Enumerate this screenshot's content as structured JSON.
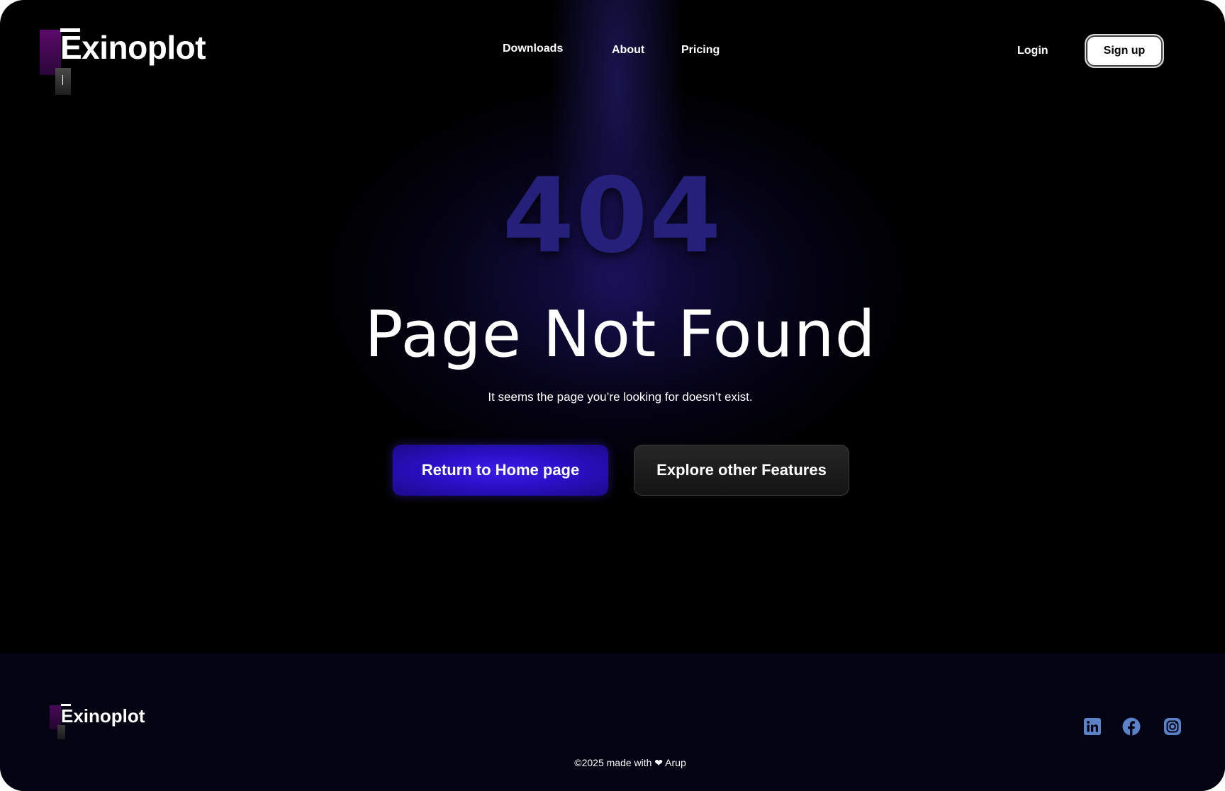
{
  "brand": {
    "name": "Exinoplot"
  },
  "nav": {
    "downloads": "Downloads",
    "about": "About",
    "pricing": "Pricing"
  },
  "auth": {
    "login": "Login",
    "signup": "Sign up"
  },
  "hero": {
    "code": "404",
    "title": "Page Not Found",
    "subtitle": "It seems the page you’re looking for doesn’t exist.",
    "primary_button": "Return to Home page",
    "secondary_button": "Explore other Features"
  },
  "footer": {
    "brand": "Exinoplot",
    "copyright": "©2025 made with ❤ Arup",
    "social_icons": [
      "linkedin-icon",
      "facebook-icon",
      "instagram-icon"
    ],
    "icon_color": "#5b82c8"
  },
  "colors": {
    "accent": "#3b1ee8",
    "background": "#000000",
    "footer_bg": "#030313"
  }
}
